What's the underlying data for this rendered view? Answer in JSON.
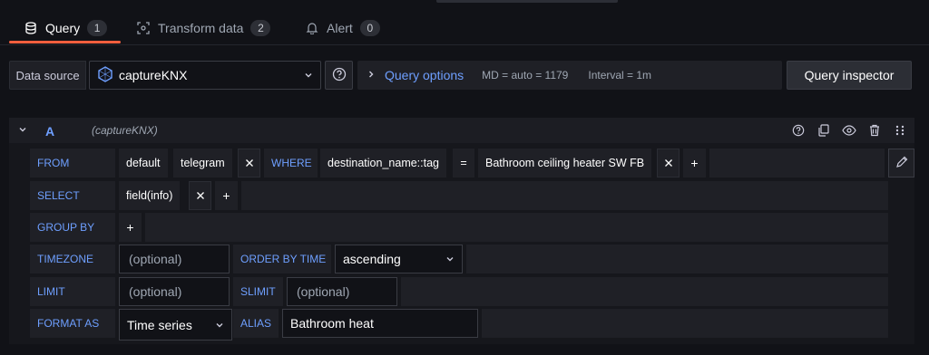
{
  "tabs": [
    {
      "label": "Query",
      "count": "1",
      "icon": "database-icon"
    },
    {
      "label": "Transform data",
      "count": "2",
      "icon": "transform-icon"
    },
    {
      "label": "Alert",
      "count": "0",
      "icon": "bell-icon"
    }
  ],
  "datasource": {
    "label": "Data source",
    "name": "captureKNX"
  },
  "query_options": {
    "title": "Query options",
    "md": "MD = auto = 1179",
    "interval": "Interval = 1m"
  },
  "query_inspector": "Query inspector",
  "query": {
    "letter": "A",
    "source": "(captureKNX)",
    "from": {
      "keyword": "FROM",
      "policy": "default",
      "measurement": "telegram",
      "where_kw": "WHERE",
      "tag": "destination_name::tag",
      "op": "=",
      "value": "Bathroom ceiling heater SW FB",
      "plus": "+"
    },
    "select": {
      "keyword": "SELECT",
      "field": "field(info)",
      "plus": "+"
    },
    "group_by": {
      "keyword": "GROUP BY",
      "plus": "+"
    },
    "timezone": {
      "keyword": "TIMEZONE",
      "placeholder": "(optional)"
    },
    "order_by": {
      "keyword": "ORDER BY TIME",
      "value": "ascending"
    },
    "limit": {
      "keyword": "LIMIT",
      "placeholder": "(optional)"
    },
    "slimit": {
      "keyword": "SLIMIT",
      "placeholder": "(optional)"
    },
    "format_as": {
      "keyword": "FORMAT AS",
      "value": "Time series"
    },
    "alias": {
      "keyword": "ALIAS",
      "value": "Bathroom heat"
    }
  },
  "colors": {
    "accent": "#6e9fff",
    "active_tab": "#f55f3e",
    "background": "#111217"
  }
}
